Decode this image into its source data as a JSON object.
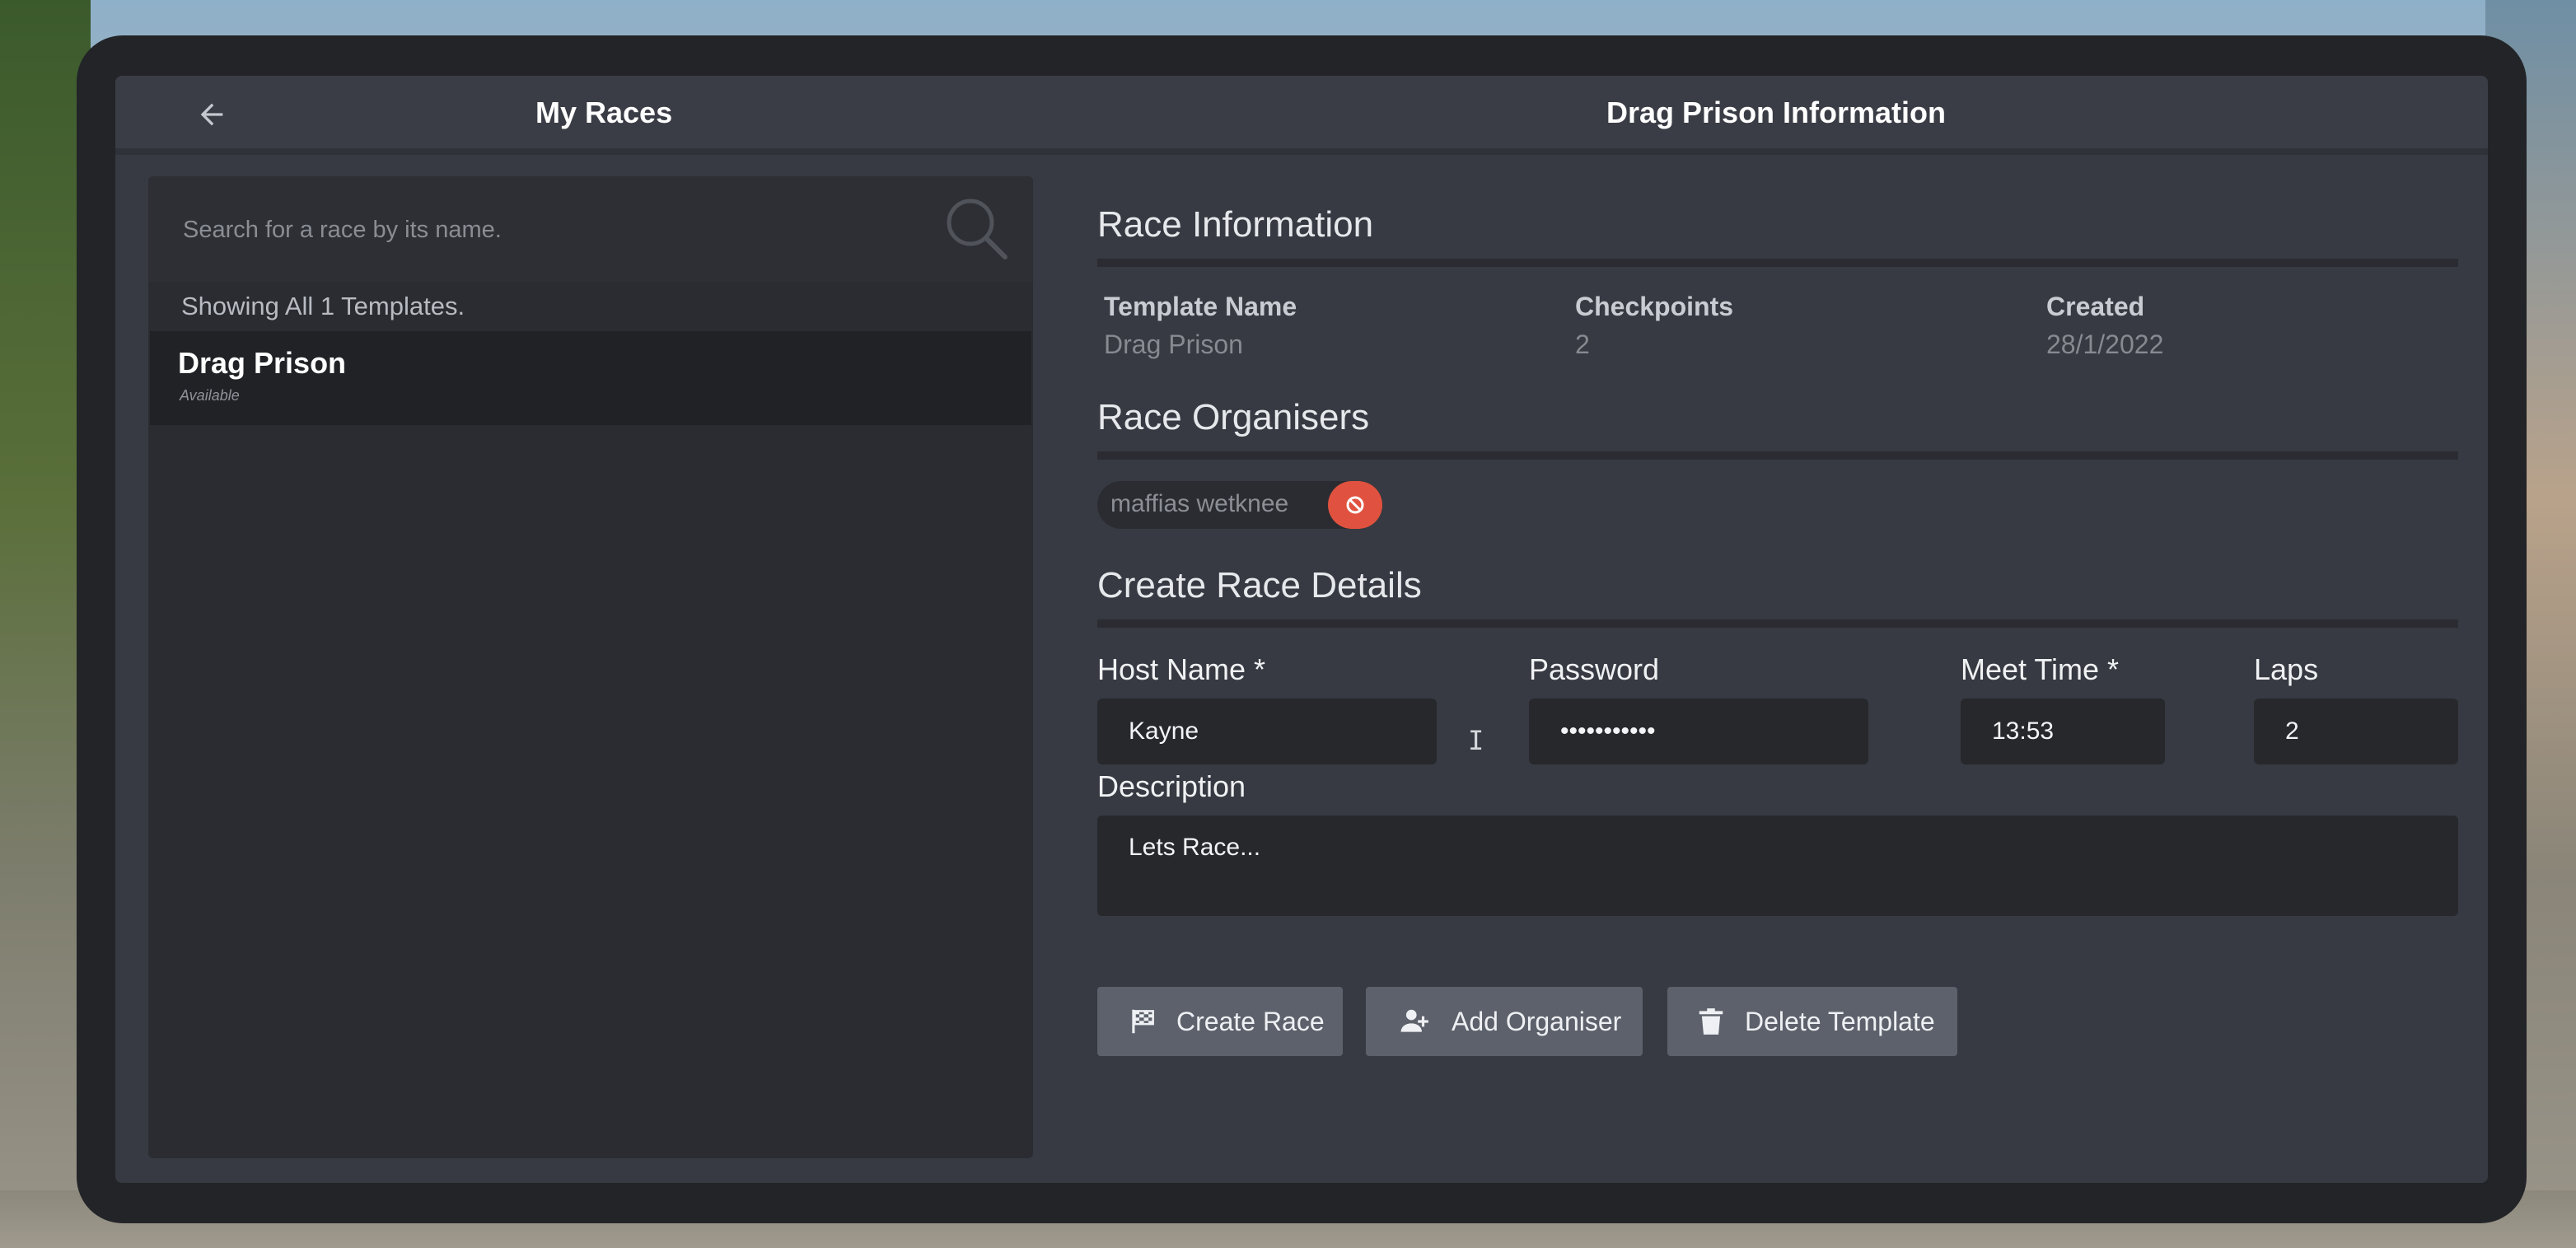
{
  "header": {
    "back_icon": "arrow-left-icon",
    "left_title": "My Races",
    "right_title": "Drag Prison Information"
  },
  "search": {
    "placeholder": "Search for a race by its name.",
    "value": "",
    "icon": "search-icon"
  },
  "list": {
    "count_text": "Showing All 1 Templates.",
    "items": [
      {
        "title": "Drag Prison",
        "status": "Available"
      }
    ]
  },
  "race_information": {
    "section_title": "Race Information",
    "template_name_label": "Template Name",
    "template_name_value": "Drag Prison",
    "checkpoints_label": "Checkpoints",
    "checkpoints_value": "2",
    "created_label": "Created",
    "created_value": "28/1/2022"
  },
  "race_organisers": {
    "section_title": "Race Organisers",
    "organisers": [
      {
        "name": "maffias wetknee",
        "remove_icon": "ban-icon"
      }
    ]
  },
  "create_race_details": {
    "section_title": "Create Race Details",
    "host_name_label": "Host Name *",
    "host_name_value": "Kayne",
    "password_label": "Password",
    "password_value": "•••••••••••",
    "meet_time_label": "Meet Time *",
    "meet_time_value": "13:53",
    "laps_label": "Laps",
    "laps_value": "2",
    "description_label": "Description",
    "description_value": "Lets Race..."
  },
  "actions": {
    "create_race": {
      "label": "Create Race",
      "icon": "checkered-flag-icon"
    },
    "add_organiser": {
      "label": "Add Organiser",
      "icon": "user-plus-icon"
    },
    "delete_template": {
      "label": "Delete Template",
      "icon": "trash-icon"
    }
  },
  "colors": {
    "frame": "#222428",
    "panel": "#373a42",
    "input_bg": "#26282c",
    "remove_button": "#e0523f",
    "button": "#5c616b"
  }
}
